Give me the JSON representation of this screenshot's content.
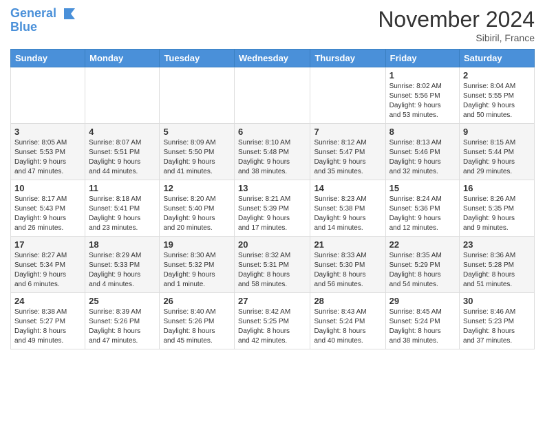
{
  "logo": {
    "line1": "General",
    "line2": "Blue"
  },
  "title": "November 2024",
  "location": "Sibiril, France",
  "days_of_week": [
    "Sunday",
    "Monday",
    "Tuesday",
    "Wednesday",
    "Thursday",
    "Friday",
    "Saturday"
  ],
  "weeks": [
    [
      {
        "day": "",
        "info": ""
      },
      {
        "day": "",
        "info": ""
      },
      {
        "day": "",
        "info": ""
      },
      {
        "day": "",
        "info": ""
      },
      {
        "day": "",
        "info": ""
      },
      {
        "day": "1",
        "info": "Sunrise: 8:02 AM\nSunset: 5:56 PM\nDaylight: 9 hours\nand 53 minutes."
      },
      {
        "day": "2",
        "info": "Sunrise: 8:04 AM\nSunset: 5:55 PM\nDaylight: 9 hours\nand 50 minutes."
      }
    ],
    [
      {
        "day": "3",
        "info": "Sunrise: 8:05 AM\nSunset: 5:53 PM\nDaylight: 9 hours\nand 47 minutes."
      },
      {
        "day": "4",
        "info": "Sunrise: 8:07 AM\nSunset: 5:51 PM\nDaylight: 9 hours\nand 44 minutes."
      },
      {
        "day": "5",
        "info": "Sunrise: 8:09 AM\nSunset: 5:50 PM\nDaylight: 9 hours\nand 41 minutes."
      },
      {
        "day": "6",
        "info": "Sunrise: 8:10 AM\nSunset: 5:48 PM\nDaylight: 9 hours\nand 38 minutes."
      },
      {
        "day": "7",
        "info": "Sunrise: 8:12 AM\nSunset: 5:47 PM\nDaylight: 9 hours\nand 35 minutes."
      },
      {
        "day": "8",
        "info": "Sunrise: 8:13 AM\nSunset: 5:46 PM\nDaylight: 9 hours\nand 32 minutes."
      },
      {
        "day": "9",
        "info": "Sunrise: 8:15 AM\nSunset: 5:44 PM\nDaylight: 9 hours\nand 29 minutes."
      }
    ],
    [
      {
        "day": "10",
        "info": "Sunrise: 8:17 AM\nSunset: 5:43 PM\nDaylight: 9 hours\nand 26 minutes."
      },
      {
        "day": "11",
        "info": "Sunrise: 8:18 AM\nSunset: 5:41 PM\nDaylight: 9 hours\nand 23 minutes."
      },
      {
        "day": "12",
        "info": "Sunrise: 8:20 AM\nSunset: 5:40 PM\nDaylight: 9 hours\nand 20 minutes."
      },
      {
        "day": "13",
        "info": "Sunrise: 8:21 AM\nSunset: 5:39 PM\nDaylight: 9 hours\nand 17 minutes."
      },
      {
        "day": "14",
        "info": "Sunrise: 8:23 AM\nSunset: 5:38 PM\nDaylight: 9 hours\nand 14 minutes."
      },
      {
        "day": "15",
        "info": "Sunrise: 8:24 AM\nSunset: 5:36 PM\nDaylight: 9 hours\nand 12 minutes."
      },
      {
        "day": "16",
        "info": "Sunrise: 8:26 AM\nSunset: 5:35 PM\nDaylight: 9 hours\nand 9 minutes."
      }
    ],
    [
      {
        "day": "17",
        "info": "Sunrise: 8:27 AM\nSunset: 5:34 PM\nDaylight: 9 hours\nand 6 minutes."
      },
      {
        "day": "18",
        "info": "Sunrise: 8:29 AM\nSunset: 5:33 PM\nDaylight: 9 hours\nand 4 minutes."
      },
      {
        "day": "19",
        "info": "Sunrise: 8:30 AM\nSunset: 5:32 PM\nDaylight: 9 hours\nand 1 minute."
      },
      {
        "day": "20",
        "info": "Sunrise: 8:32 AM\nSunset: 5:31 PM\nDaylight: 8 hours\nand 58 minutes."
      },
      {
        "day": "21",
        "info": "Sunrise: 8:33 AM\nSunset: 5:30 PM\nDaylight: 8 hours\nand 56 minutes."
      },
      {
        "day": "22",
        "info": "Sunrise: 8:35 AM\nSunset: 5:29 PM\nDaylight: 8 hours\nand 54 minutes."
      },
      {
        "day": "23",
        "info": "Sunrise: 8:36 AM\nSunset: 5:28 PM\nDaylight: 8 hours\nand 51 minutes."
      }
    ],
    [
      {
        "day": "24",
        "info": "Sunrise: 8:38 AM\nSunset: 5:27 PM\nDaylight: 8 hours\nand 49 minutes."
      },
      {
        "day": "25",
        "info": "Sunrise: 8:39 AM\nSunset: 5:26 PM\nDaylight: 8 hours\nand 47 minutes."
      },
      {
        "day": "26",
        "info": "Sunrise: 8:40 AM\nSunset: 5:26 PM\nDaylight: 8 hours\nand 45 minutes."
      },
      {
        "day": "27",
        "info": "Sunrise: 8:42 AM\nSunset: 5:25 PM\nDaylight: 8 hours\nand 42 minutes."
      },
      {
        "day": "28",
        "info": "Sunrise: 8:43 AM\nSunset: 5:24 PM\nDaylight: 8 hours\nand 40 minutes."
      },
      {
        "day": "29",
        "info": "Sunrise: 8:45 AM\nSunset: 5:24 PM\nDaylight: 8 hours\nand 38 minutes."
      },
      {
        "day": "30",
        "info": "Sunrise: 8:46 AM\nSunset: 5:23 PM\nDaylight: 8 hours\nand 37 minutes."
      }
    ]
  ]
}
